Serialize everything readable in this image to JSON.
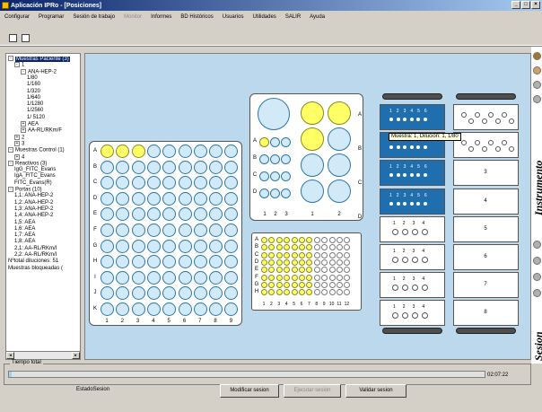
{
  "window": {
    "title": "Aplicación IPRo - [Posiciones]",
    "buttons": [
      "_",
      "□",
      "×"
    ]
  },
  "menu": [
    {
      "label": "Configurar",
      "disabled": false
    },
    {
      "label": "Programar",
      "disabled": false
    },
    {
      "label": "Sesión de trabajo",
      "disabled": false
    },
    {
      "label": "Monitor",
      "disabled": true
    },
    {
      "label": "Informes",
      "disabled": false
    },
    {
      "label": "BD Históricos",
      "disabled": false
    },
    {
      "label": "Usuarios",
      "disabled": false
    },
    {
      "label": "Utilidades",
      "disabled": false
    },
    {
      "label": "SALIR",
      "disabled": false
    },
    {
      "label": "Ayuda",
      "disabled": false
    }
  ],
  "tree": [
    {
      "label": "Muestras Paciente (3)",
      "lvl": 0,
      "exp": "-",
      "sel": true
    },
    {
      "label": "1",
      "lvl": 1,
      "exp": "-"
    },
    {
      "label": "ANA-HEP-2",
      "lvl": 2,
      "exp": "-"
    },
    {
      "label": "1/80",
      "lvl": 3
    },
    {
      "label": "1/160",
      "lvl": 3
    },
    {
      "label": "1/320",
      "lvl": 3
    },
    {
      "label": "1/640",
      "lvl": 3
    },
    {
      "label": "1/1280",
      "lvl": 3
    },
    {
      "label": "1/2560",
      "lvl": 3
    },
    {
      "label": "1/ 5120",
      "lvl": 3
    },
    {
      "label": "AEA",
      "lvl": 2,
      "exp": "+"
    },
    {
      "label": "AA-RL/RKm/F",
      "lvl": 2,
      "exp": "+"
    },
    {
      "label": "2",
      "lvl": 1,
      "exp": "+"
    },
    {
      "label": "3",
      "lvl": 1,
      "exp": "+"
    },
    {
      "label": "Muestras Control (1)",
      "lvl": 0,
      "exp": "-"
    },
    {
      "label": "4",
      "lvl": 1,
      "exp": "+"
    },
    {
      "label": "Reactivos (3)",
      "lvl": 0,
      "exp": "-"
    },
    {
      "label": "IgG_FITC_Evans",
      "lvl": 1
    },
    {
      "label": "IgA_FITC_Evans",
      "lvl": 1
    },
    {
      "label": "FITC_Evans(R)",
      "lvl": 1
    },
    {
      "label": "Portas (10)",
      "lvl": 0,
      "exp": "-"
    },
    {
      "label": "1,1: ANA-HEP-2",
      "lvl": 1
    },
    {
      "label": "1,2: ANA-HEP-2",
      "lvl": 1
    },
    {
      "label": "1,3: ANA-HEP-2",
      "lvl": 1
    },
    {
      "label": "1,4: ANA-HEP-2",
      "lvl": 1
    },
    {
      "label": "1,5: AEA",
      "lvl": 1
    },
    {
      "label": "1,6: AEA",
      "lvl": 1
    },
    {
      "label": "1,7: AEA",
      "lvl": 1
    },
    {
      "label": "1,8: AEA",
      "lvl": 1
    },
    {
      "label": "2,1: AA-RL/RKm/I",
      "lvl": 1
    },
    {
      "label": "2,2: AA-RL/RKm/I",
      "lvl": 1
    },
    {
      "label": "Nºtotal diluciones: 51",
      "lvl": 0
    },
    {
      "label": "Muestras bloqueadas (",
      "lvl": 0
    }
  ],
  "plate96": {
    "rows": [
      "A",
      "B",
      "C",
      "D",
      "E",
      "F",
      "G",
      "H",
      "I",
      "J",
      "K"
    ],
    "cols": [
      "1",
      "2",
      "3",
      "4",
      "5",
      "6",
      "7",
      "8",
      "9"
    ],
    "filled": [
      "A1",
      "A2",
      "A3"
    ]
  },
  "reagentRack": {
    "rows": [
      "A",
      "B",
      "C",
      "D"
    ],
    "smallCols": [
      "1",
      "2",
      "3"
    ],
    "bigCols": [
      "1",
      "2"
    ],
    "filledSmall": [
      "A1"
    ],
    "filledBig": [
      "A1",
      "A2",
      "B1"
    ]
  },
  "microplate": {
    "rows": [
      "A",
      "B",
      "C",
      "D",
      "E",
      "F",
      "G",
      "H"
    ],
    "cols": [
      "1",
      "2",
      "3",
      "4",
      "5",
      "6",
      "7",
      "8",
      "9",
      "10",
      "11",
      "12"
    ],
    "filledCols": 7
  },
  "slideRack1": [
    {
      "type": "blue",
      "nums": [
        "1",
        "2",
        "3",
        "4",
        "5",
        "6"
      ]
    },
    {
      "type": "blue",
      "nums": [
        "1",
        "2",
        "3",
        "4",
        "5",
        "6"
      ]
    },
    {
      "type": "blue",
      "nums": [
        "1",
        "2",
        "3",
        "4",
        "5",
        "6"
      ]
    },
    {
      "type": "blue",
      "nums": [
        "1",
        "2",
        "3",
        "4",
        "5",
        "6"
      ]
    },
    {
      "type": "white",
      "nums": [
        "1",
        "2",
        "3",
        "4"
      ]
    },
    {
      "type": "white",
      "nums": [
        "1",
        "2",
        "3",
        "4"
      ]
    },
    {
      "type": "white",
      "nums": [
        "1",
        "2",
        "3",
        "4"
      ]
    },
    {
      "type": "white",
      "nums": [
        "1",
        "2",
        "3",
        "4"
      ]
    }
  ],
  "slideRack2": [
    {
      "type": "pattern",
      "label": ""
    },
    {
      "type": "pattern",
      "label": ""
    },
    {
      "type": "empty",
      "label": "3"
    },
    {
      "type": "empty",
      "label": "4"
    },
    {
      "type": "empty",
      "label": "5"
    },
    {
      "type": "empty",
      "label": "6"
    },
    {
      "type": "empty",
      "label": "7"
    },
    {
      "type": "empty",
      "label": "8"
    }
  ],
  "tooltip": "Muestra: 1, Dilución: 1, 1/80",
  "side": {
    "top": "Instrumento",
    "bottom": "Sesion"
  },
  "progress": {
    "legend": "Tiempo total",
    "value": 0.005,
    "elapsed": "02:07:22"
  },
  "status": "EstadoSesion",
  "buttons": {
    "modify": "Modificar sesion",
    "run": "Ejecutar sesion",
    "validate": "Validar sesion"
  }
}
